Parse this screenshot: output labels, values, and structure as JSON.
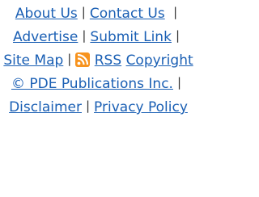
{
  "footer": {
    "links": {
      "about_us": "About Us",
      "contact_us": "Contact Us",
      "advertise": "Advertise",
      "submit_link": "Submit Link",
      "site_map": "Site Map",
      "rss": "RSS",
      "copyright": "Copyright © PDE Publications Inc.",
      "disclaimer": "Disclaimer",
      "privacy_policy": "Privacy Policy"
    },
    "separator": "|",
    "icons": {
      "rss": "rss-feed-icon"
    },
    "colors": {
      "link": "#1a5fb4",
      "rss_orange": "#f7931e"
    }
  }
}
